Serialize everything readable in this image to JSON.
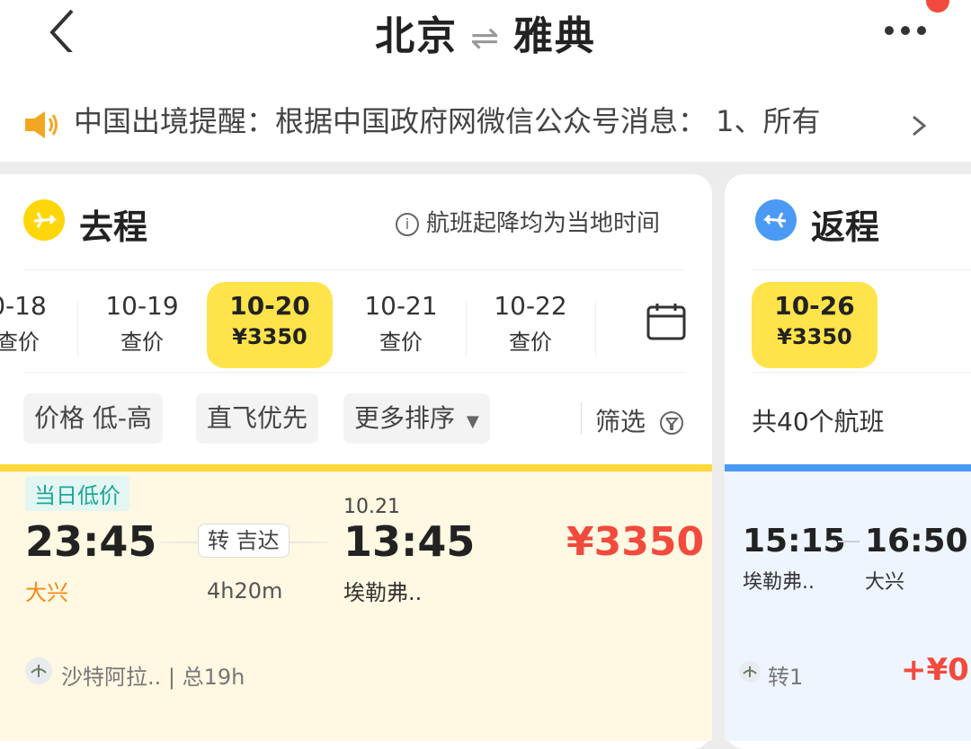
{
  "header": {
    "from": "北京",
    "swap": "⇌",
    "to": "雅典",
    "notice": "中国出境提醒：根据中国政府网微信公众号消息：    1、所有"
  },
  "outbound": {
    "title": "去程",
    "hint": "航班起降均为当地时间",
    "dates": [
      {
        "date": "0-18",
        "price": "查价"
      },
      {
        "date": "10-19",
        "price": "查价"
      },
      {
        "date": "10-20",
        "price": "¥3350"
      },
      {
        "date": "10-21",
        "price": "查价"
      },
      {
        "date": "10-22",
        "price": "查价"
      }
    ],
    "sort": {
      "price": "价格 低-高",
      "direct": "直飞优先",
      "more": "更多排序",
      "filter": "筛选"
    },
    "flight": {
      "tag": "当日低价",
      "dep_time": "23:45",
      "dep_airport": "大兴",
      "transfer": "转 吉达",
      "duration": "4h20m",
      "arr_date": "10.21",
      "arr_time": "13:45",
      "arr_airport": "埃勒弗..",
      "price": "¥3350",
      "airline": "沙特阿拉.. | 总19h"
    }
  },
  "return": {
    "title": "返程",
    "date": "10-26",
    "price": "¥3350",
    "count": "共40个航班",
    "flight": {
      "dep_time": "15:15",
      "dep_airport": "埃勒弗..",
      "arr_time": "16:50",
      "arr_airport": "大兴",
      "transfer": "转1",
      "price": "+¥0"
    }
  },
  "colors": {
    "accent_yellow": "#ffe34a",
    "price_red": "#f24a3d",
    "return_blue": "#4a9af5",
    "tag_teal": "#1aa895"
  }
}
